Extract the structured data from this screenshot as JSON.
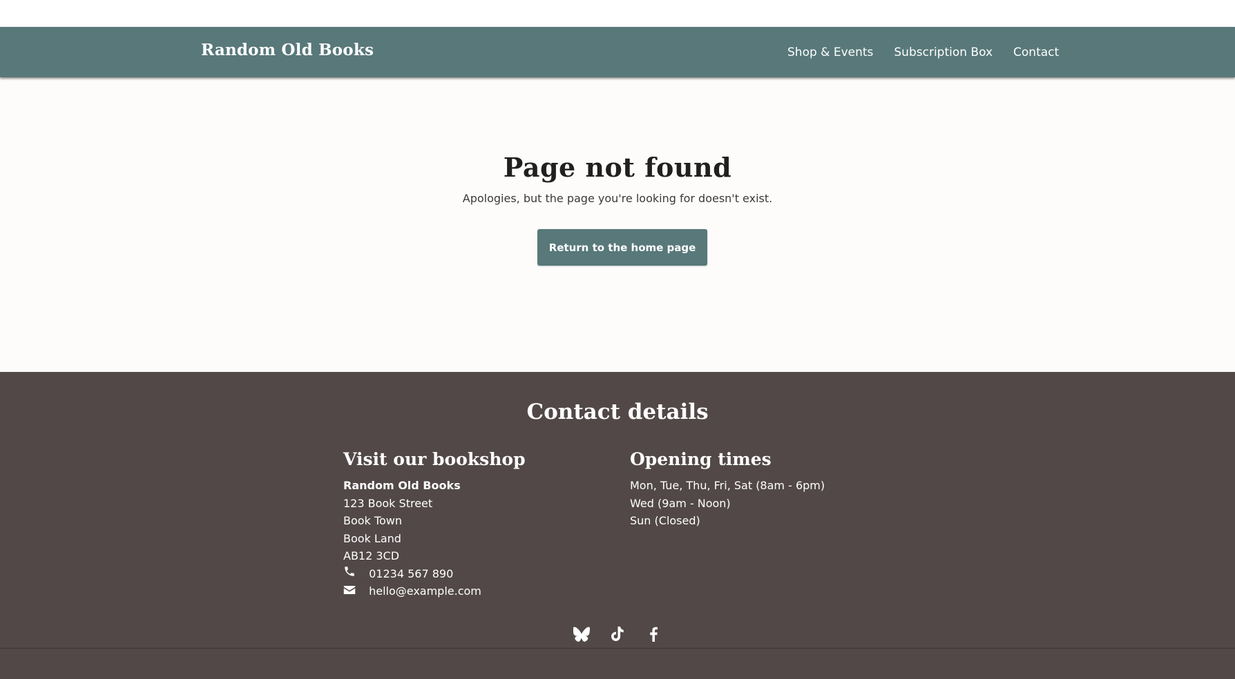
{
  "header": {
    "brand": "Random Old Books",
    "nav": [
      "Shop & Events",
      "Subscription Box",
      "Contact"
    ]
  },
  "main": {
    "title": "Page not found",
    "message": "Apologies, but the page you're looking for doesn't exist.",
    "button_label": "Return to the home page"
  },
  "footer": {
    "title": "Contact details",
    "visit": {
      "heading": "Visit our bookshop",
      "name": "Random Old Books",
      "address": [
        "123 Book Street",
        "Book Town",
        "Book Land",
        "AB12 3CD"
      ],
      "phone": "01234 567 890",
      "email": "hello@example.com"
    },
    "hours": {
      "heading": "Opening times",
      "lines": [
        "Mon, Tue, Thu, Fri, Sat (8am - 6pm)",
        "Wed (9am - Noon)",
        "Sun (Closed)"
      ]
    },
    "social_icons": [
      "bluesky-icon",
      "tiktok-icon",
      "facebook-icon"
    ]
  },
  "colors": {
    "header_bg": "#58787a",
    "footer_bg": "#524848",
    "button_bg": "#58787a",
    "page_bg": "#fdfcfb"
  }
}
